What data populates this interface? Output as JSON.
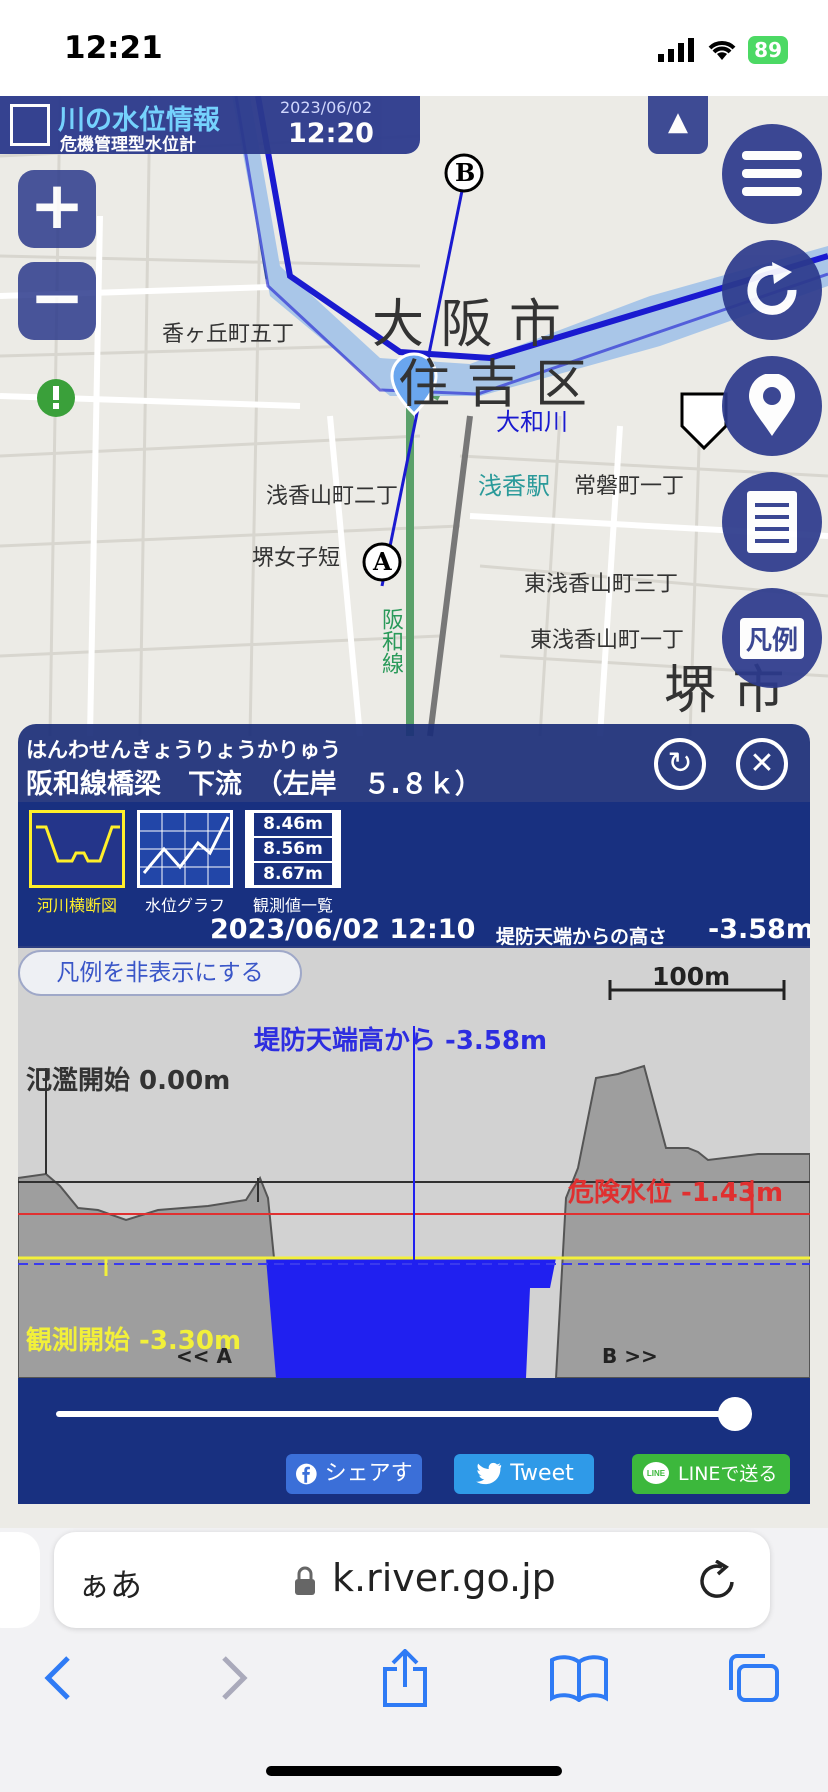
{
  "status_bar": {
    "time": "12:21",
    "battery": "89"
  },
  "app": {
    "title": "川の水位情報",
    "subtitle": "危機管理型水位計",
    "date": "2023/06/02",
    "time": "12:20"
  },
  "map": {
    "labels": [
      {
        "name": "osaka-city-label",
        "text": "大 阪 市"
      },
      {
        "name": "sumiyoshi-ward-label",
        "text": "住 吉 区"
      },
      {
        "name": "sakai-city-label",
        "text": "堺 市"
      },
      {
        "name": "yamatogawa-label",
        "text": "大和川"
      },
      {
        "name": "asaka-station-label",
        "text": "浅香駅"
      },
      {
        "name": "tokiwacho-label",
        "text": "常磐町一丁"
      },
      {
        "name": "kagaokacho-label",
        "text": "香ヶ丘町五丁"
      },
      {
        "name": "asakayama-label",
        "text": "浅香山町二丁"
      },
      {
        "name": "higashi-asakayama-3-label",
        "text": "東浅香山町三丁"
      },
      {
        "name": "higashi-asakayama-1-label",
        "text": "東浅香山町一丁"
      },
      {
        "name": "sakaijoshi-label",
        "text": "堺女子短"
      },
      {
        "name": "hanwa-line-label",
        "text": "阪和線"
      }
    ],
    "point_a": "A",
    "point_b": "B",
    "legend_button": "凡例"
  },
  "panel": {
    "station_kana": "はんわせんきょうりょうかりゅう",
    "station_name": "阪和線橋梁　下流　（左岸　５.８ｋ）",
    "tabs": [
      {
        "label": "河川横断図"
      },
      {
        "label": "水位グラフ"
      },
      {
        "label": "観測値一覧"
      }
    ],
    "table_preview": [
      "8.46m",
      "8.56m",
      "8.67m"
    ],
    "observation": {
      "datetime": "2023/06/02 12:10",
      "label": "堤防天端からの高さ",
      "value": "-3.58m"
    },
    "legend_toggle": "凡例を非表示にする",
    "scale_label": "100m",
    "cross_section": {
      "levee_label": "堤防天端高から -3.58m",
      "flood_label": "氾濫開始 0.00m",
      "danger_label": "危険水位 -1.43m",
      "obs_start_label": "観測開始 -3.30m",
      "side_a": "<< A",
      "side_b": "B >>",
      "colors": {
        "water": "#2020f0",
        "danger": "#e03030",
        "obs_start": "#f2f03a",
        "levee": "#303030"
      }
    },
    "slider_position": 1.0,
    "share": {
      "facebook": "シェアする",
      "twitter": "Tweet",
      "line": "LINEで送る"
    }
  },
  "browser": {
    "aa": "ぁあ",
    "url": "k.river.go.jp"
  }
}
